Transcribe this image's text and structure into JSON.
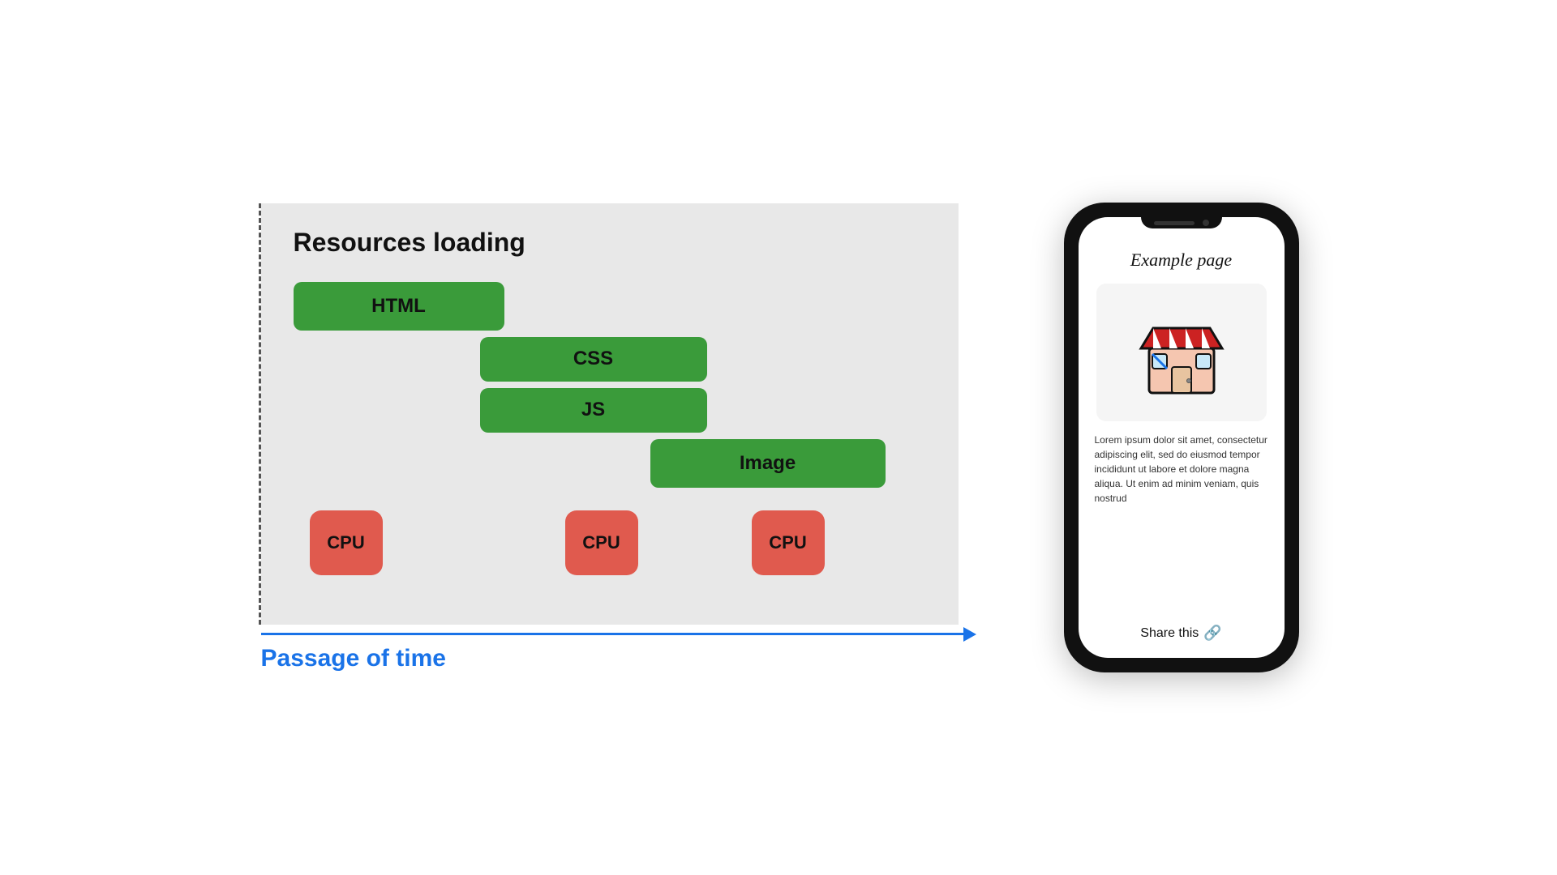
{
  "diagram": {
    "title": "Resources loading",
    "bars": [
      {
        "id": "html",
        "label": "HTML"
      },
      {
        "id": "css",
        "label": "CSS"
      },
      {
        "id": "js",
        "label": "JS"
      },
      {
        "id": "image",
        "label": "Image"
      }
    ],
    "cpu_labels": [
      "CPU",
      "CPU",
      "CPU"
    ],
    "time_label": "Passage of time"
  },
  "phone": {
    "page_title": "Example page",
    "lorem_text": "Lorem ipsum dolor sit amet, consectetur adipiscing elit, sed do eiusmod tempor incididunt ut labore et dolore magna aliqua. Ut enim ad minim veniam, quis nostrud",
    "share_label": "Share this",
    "share_icon_label": "🔗"
  }
}
